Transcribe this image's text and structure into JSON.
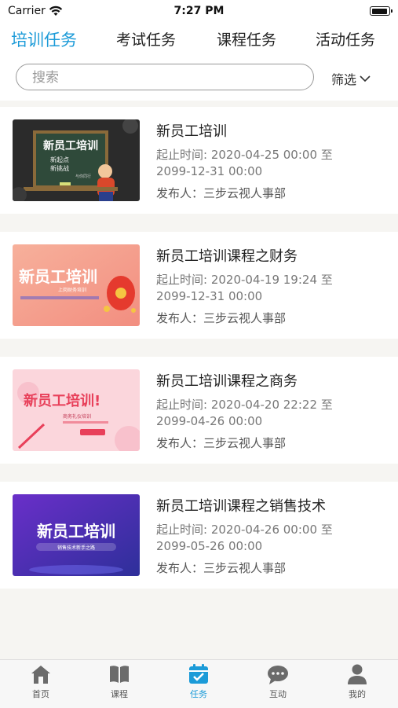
{
  "status_bar": {
    "carrier": "Carrier",
    "time": "7:27 PM"
  },
  "tabs": [
    {
      "label": "培训任务",
      "active": true
    },
    {
      "label": "考试任务",
      "active": false
    },
    {
      "label": "课程任务",
      "active": false
    },
    {
      "label": "活动任务",
      "active": false
    }
  ],
  "search": {
    "placeholder": "搜索",
    "value": ""
  },
  "filter": {
    "label": "筛选",
    "icon": "chevron-down-icon"
  },
  "tasks": [
    {
      "title": "新员工培训",
      "dates_line1": "起止时间: 2020-04-25 00:00 至",
      "dates_line2": "2099-12-31 00:00",
      "publisher": "发布人：三步云视人事部",
      "thumb": {
        "headline": "新员工培训",
        "line1": "新起点",
        "line2": "新挑战",
        "line3": "与你同行",
        "style": "chalkboard"
      }
    },
    {
      "title": "新员工培训课程之财务",
      "dates_line1": "起止时间: 2020-04-19 19:24 至",
      "dates_line2": "2099-12-31 00:00",
      "publisher": "发布人：三步云视人事部",
      "thumb": {
        "headline": "新员工培训",
        "line1": "上岗财务培训",
        "line2": "",
        "line3": "",
        "style": "salmon"
      }
    },
    {
      "title": "新员工培训课程之商务",
      "dates_line1": "起止时间: 2020-04-20 22:22 至",
      "dates_line2": "2099-04-26 00:00",
      "publisher": "发布人：三步云视人事部",
      "thumb": {
        "headline": "新员工培训!",
        "line1": "商务礼仪培训",
        "line2": "",
        "line3": "",
        "style": "pink"
      }
    },
    {
      "title": "新员工培训课程之销售技术",
      "dates_line1": "起止时间: 2020-04-26 00:00 至",
      "dates_line2": "2099-05-26 00:00",
      "publisher": "发布人：三步云视人事部",
      "thumb": {
        "headline": "新员工培训",
        "line1": "销售技术新手之路",
        "line2": "",
        "line3": "",
        "style": "purple"
      }
    }
  ],
  "tabbar": [
    {
      "label": "首页",
      "icon": "home-icon",
      "active": false
    },
    {
      "label": "课程",
      "icon": "book-icon",
      "active": false
    },
    {
      "label": "任务",
      "icon": "task-icon",
      "active": true
    },
    {
      "label": "互动",
      "icon": "chat-icon",
      "active": false
    },
    {
      "label": "我的",
      "icon": "user-icon",
      "active": false
    }
  ],
  "colors": {
    "accent": "#1c9bd8",
    "inactive_icon": "#6b6b6b",
    "background": "#f6f5f2"
  }
}
